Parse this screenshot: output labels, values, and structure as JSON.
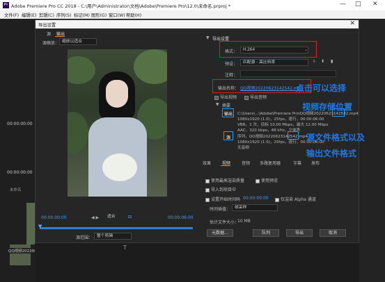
{
  "window": {
    "title": "Adobe Premiere Pro CC 2018 - C:\\用户\\Administrator\\文档\\Adobe\\Premiere Pro\\12.0\\未命名.prproj *",
    "min": "—",
    "max": "□",
    "close": "✕"
  },
  "menu": [
    "文件(F)",
    "编辑(E)",
    "剪辑(C)",
    "序列(S)",
    "标记(M)",
    "图形(G)",
    "窗口(W)",
    "帮助(H)"
  ],
  "dialog": {
    "title": "导出设置",
    "close": "✕",
    "left_tabs": [
      "源",
      "输出"
    ],
    "source_scaling_label": "源缩放：",
    "source_scaling_value": "缩放以适合",
    "export_settings_header": "导出设置",
    "format_label": "格式：",
    "format_value": "H.264",
    "preset_label": "预设：",
    "preset_value": "匹配源 - 高比特率",
    "comments_label": "注释：",
    "output_name_label": "输出名称：",
    "output_name_value": "QQ视频20220623142542.mp4",
    "export_video": "导出视频",
    "export_audio": "导出音频",
    "summary_label": "摘要",
    "output_tag": "输出",
    "output_lines": [
      "C:\\Users\\...\\Adobe\\Premiere Pro\\QQ视频20220623142542.mp4",
      "1080x1920 (1.0)，25fps，逐行，00:00:06:00",
      "VBR，1 次，目标 10.00 Mbps，最大 12.00 Mbps",
      "AAC，320 kbps，48 kHz，立体声"
    ],
    "source_tag": "源",
    "source_lines": [
      "序列，QQ视频20220623142542.mp4",
      "1080x1920 (1.0)，25fps，逐行，00:00:06:00",
      "无音频"
    ],
    "settings_tabs": [
      "效果",
      "视频",
      "音频",
      "多路复用器",
      "字幕",
      "发布"
    ],
    "options": [
      "使用最高渲染质量",
      "使用预览",
      "导入到项目中",
      "设置开始时间码",
      "仅渲染 Alpha 通道"
    ],
    "start_timecode": "00:00:00:00",
    "interp_label": "时间插值：",
    "interp_value": "帧采样",
    "filesize_label": "估计文件大小：",
    "filesize_value": "10 MB",
    "buttons": {
      "metadata": "元数据...",
      "queue": "队列",
      "export": "导出",
      "cancel": "取消"
    },
    "tc_start": "00:00:00:00",
    "tc_end": "00:00:06:00",
    "fit_value": "适合",
    "source_range_label": "源范围：",
    "source_range_value": "整个剪辑"
  },
  "background": {
    "left_tc1": "00:00:00:00",
    "left_tc2": "00:00:00:00",
    "panel_label": "未命名",
    "file_caption": "QQ视频20220623142542.mp4"
  },
  "annotations": {
    "click_choose": "点击可以选择",
    "storage_loc": "视频存储位置",
    "src_output_1": "源文件格式以及",
    "src_output_2": "输出文件格式"
  },
  "colors": {
    "red_box": "#e01b24",
    "blue_box": "#1e9bff",
    "annotation": "#1e78e6",
    "link": "#3aa0ff"
  }
}
